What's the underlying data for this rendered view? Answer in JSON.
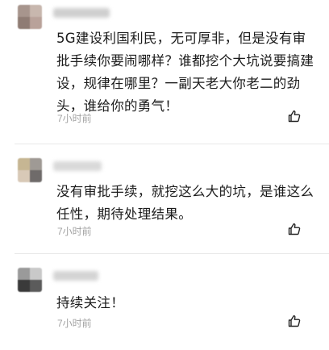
{
  "comments": [
    {
      "text": "5G建设利国利民，无可厚非，但是没有审\n批手续你要闹哪样？谁都挖个大坑说要搞建\n设，规律在哪里？一副天老大你老二的劲\n头，谁给你的勇气！",
      "time": "7小时前",
      "avatar_colors": [
        "#a7958d",
        "#c8b7ae",
        "#8f7c74",
        "#b9a29a"
      ],
      "username_color": "#cfcfcf"
    },
    {
      "text": "没有审批手续，就挖这么大的坑，是谁这么\n任性，期待处理结果。",
      "time": "7小时前",
      "avatar_colors": [
        "#c6b693",
        "#9f9a95",
        "#d8c9b7",
        "#6f6b6a"
      ],
      "username_color": "#d9d9d9"
    },
    {
      "text": "持续关注！",
      "time": "7小时前",
      "avatar_colors": [
        "#9a9a9a",
        "#c9c9c9",
        "#3a3a3a",
        "#5b5b5b"
      ],
      "username_color": "#d4d4d4"
    }
  ],
  "icons": {
    "like": "thumbs-up-icon"
  },
  "colors": {
    "time": "#a3a3a3",
    "divider": "#e9e9e9"
  }
}
